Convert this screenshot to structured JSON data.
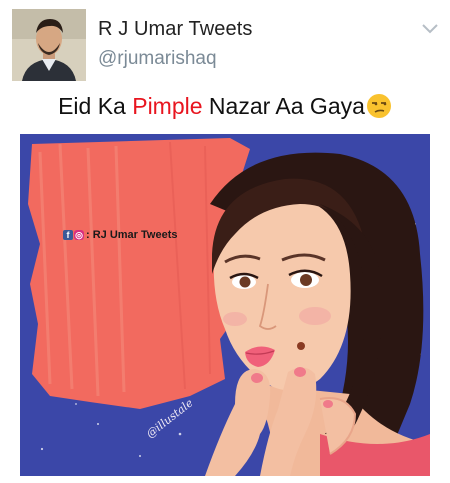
{
  "tweet": {
    "display_name": "R J Umar Tweets",
    "handle": "@rjumarishaq",
    "menu_icon": "chevron-down-icon"
  },
  "caption": {
    "part1": "Eid Ka ",
    "highlight": "Pimple",
    "part2": " Nazar Aa Gaya",
    "emoji": "unamused-face-emoji",
    "highlight_color": "#e8151f"
  },
  "image": {
    "watermark_icons": [
      "facebook-icon",
      "instagram-icon"
    ],
    "watermark_text": ": RJ Umar Tweets",
    "artist_signature": "@illustale",
    "colors": {
      "background": "#3b47a8",
      "brush": "#f26a5f",
      "hair": "#2a1612",
      "skin": "#f6c9ac"
    }
  }
}
